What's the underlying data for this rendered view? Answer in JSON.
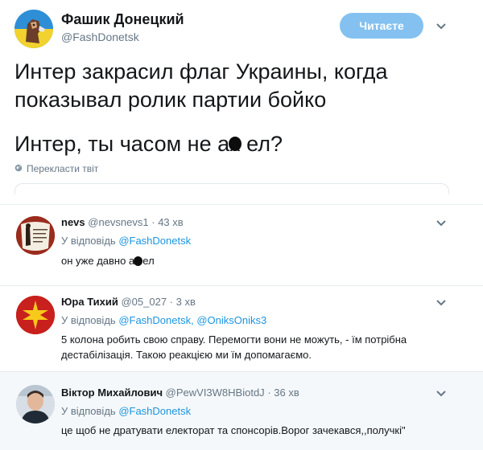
{
  "author": {
    "name": "Фашик Донецкий",
    "handle": "@FashDonetsk"
  },
  "follow_button": "Читаєте",
  "tweet": {
    "text": "Интер закрасил флаг Украины, когда\nпоказывал ролик партии бойко",
    "line3": "Интер, ты часом не ах ел?"
  },
  "translate_label": "Перекласти твіт",
  "replies": [
    {
      "name": "nevs",
      "handle": "@nevsnevs1",
      "time": "· 43 хв",
      "replying_prefix": "У відповідь",
      "replying_to": [
        "@FashDonetsk"
      ],
      "text": "он уже давно ах ел"
    },
    {
      "name": "Юра Тихий",
      "handle": "@05_027",
      "time": "· 3 хв",
      "replying_prefix": "У відповідь",
      "replying_to": [
        "@FashDonetsk",
        "@OniksOniks3"
      ],
      "replying_sep": ",",
      "text": "5 колона робить свою справу. Перемогти вони не можуть, - їм потрібна дестабілізація. Такою реакцією ми їм допомагаємо."
    },
    {
      "name": "Віктор Михайлович",
      "handle": "@PewVI3W8HBiotdJ",
      "time": "· 36 хв",
      "replying_prefix": "У відповідь",
      "replying_to": [
        "@FashDonetsk"
      ],
      "text": "це щоб не дратувати електорат та спонсорів.Ворог зачекався,,получкі\""
    }
  ],
  "colors": {
    "accent": "#1b95e0",
    "follow_bg": "#84c1f0",
    "muted": "#657786",
    "highlight_bg": "#f5f8fa"
  },
  "icons": [
    "chevron-down-icon",
    "globe-icon"
  ]
}
